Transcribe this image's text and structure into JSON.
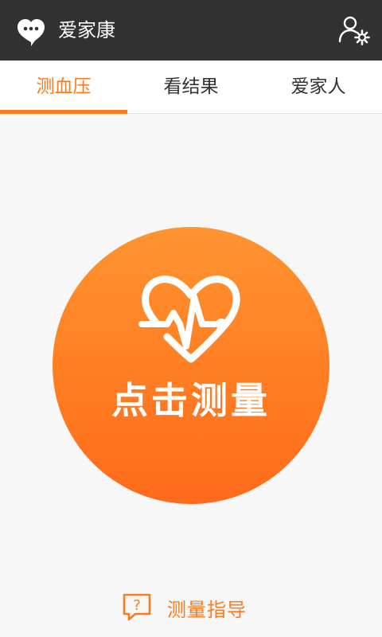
{
  "app": {
    "title": "爱家康",
    "logo_icon": "chat-heart-logo-icon",
    "settings_icon": "user-settings-icon"
  },
  "tabs": [
    {
      "label": "测血压",
      "active": true
    },
    {
      "label": "看结果",
      "active": false
    },
    {
      "label": "爱家人",
      "active": false
    }
  ],
  "measure": {
    "label": "点击测量",
    "icon": "heart-pulse-icon"
  },
  "guide": {
    "label": "测量指导",
    "icon": "help-chat-icon"
  },
  "colors": {
    "accent": "#ff7a1c",
    "titlebar": "#323232",
    "background": "#f7f7f7"
  }
}
